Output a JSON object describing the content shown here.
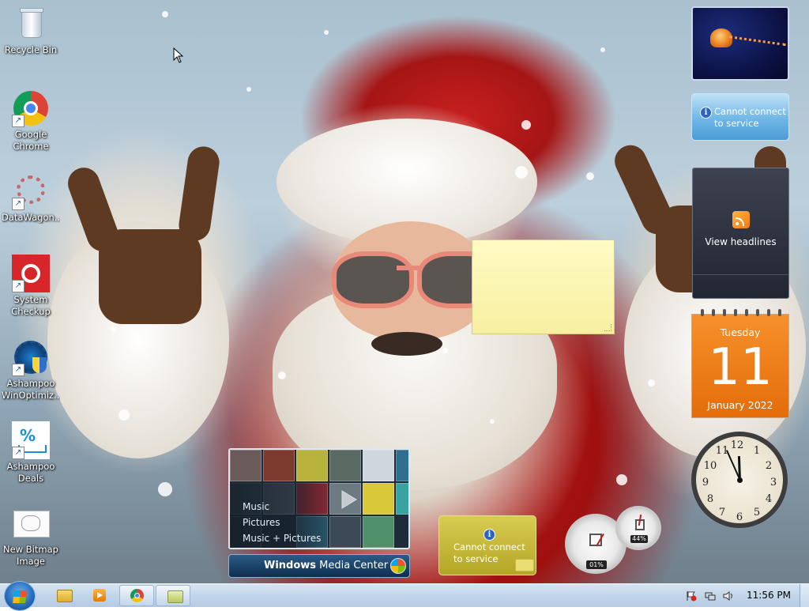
{
  "desktop_icons": [
    {
      "label": "Recycle Bin",
      "icon": "recycle-bin-icon"
    },
    {
      "label": "Google\nChrome",
      "icon": "chrome-icon"
    },
    {
      "label": "DataWagon...",
      "icon": "datawagon-icon"
    },
    {
      "label": "System\nCheckup",
      "icon": "system-checkup-icon"
    },
    {
      "label": "Ashampoo\nWinOptimiz...",
      "icon": "winoptimizer-icon"
    },
    {
      "label": "Ashampoo\nDeals",
      "icon": "shopping-cart-icon"
    },
    {
      "label": "New Bitmap\nImage",
      "icon": "bitmap-file-icon"
    }
  ],
  "gadgets": {
    "weather": {
      "message": "Cannot connect to service"
    },
    "feed": {
      "message": "View headlines"
    },
    "calendar": {
      "weekday": "Tuesday",
      "day": "11",
      "month_year": "January 2022"
    },
    "clock": {
      "numbers": [
        "12",
        "1",
        "2",
        "3",
        "4",
        "5",
        "6",
        "7",
        "8",
        "9",
        "10",
        "11"
      ],
      "time": "11:56"
    },
    "currency": {
      "message": "Cannot connect to service"
    },
    "cpu_meter": {
      "cpu": "01%",
      "memory": "44%"
    },
    "media_center": {
      "menu": [
        "Music",
        "Pictures",
        "Music + Pictures"
      ],
      "title_bold": "Windows",
      "title_rest": " Media Center"
    }
  },
  "taskbar": {
    "pinned": [
      "file-explorer-icon",
      "media-player-icon",
      "chrome-icon",
      "folder-icon"
    ],
    "tray": [
      "action-center-flag-icon",
      "network-icon",
      "volume-icon"
    ],
    "time": "11:56 PM"
  },
  "colors": {
    "taskbar": "#c4d7ea",
    "calendar": "#f07c0c",
    "sticky": "#fff7b0"
  }
}
